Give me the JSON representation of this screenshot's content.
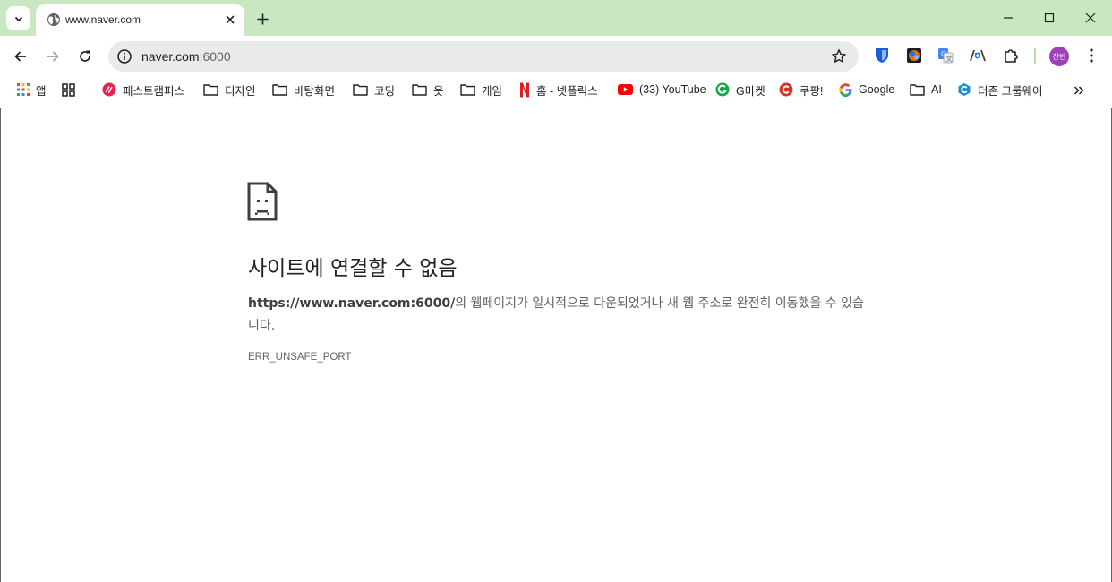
{
  "tab": {
    "title": "www.naver.com"
  },
  "omnibox": {
    "host": "naver.com",
    "port": ":6000"
  },
  "profile": {
    "initials": "찬빈",
    "color": "#9c3fb8"
  },
  "extensions": [
    "bitwarden-icon",
    "color-picker-icon",
    "google-translate-icon",
    "redux-devtools-icon",
    "puzzle-extensions-icon"
  ],
  "bookmarks": {
    "apps_label": "앱",
    "items": [
      {
        "label": "패스트캠퍼스",
        "icon": "fastcampus-icon"
      },
      {
        "label": "디자인",
        "icon": "folder-icon"
      },
      {
        "label": "바탕화면",
        "icon": "folder-icon"
      },
      {
        "label": "코딩",
        "icon": "folder-icon"
      },
      {
        "label": "옷",
        "icon": "folder-icon"
      },
      {
        "label": "게임",
        "icon": "folder-icon"
      },
      {
        "label": "홈 - 넷플릭스",
        "icon": "netflix-icon"
      },
      {
        "label": "(33) YouTube",
        "icon": "youtube-icon"
      },
      {
        "label": "G마켓",
        "icon": "gmarket-icon"
      },
      {
        "label": "쿠팡!",
        "icon": "coupang-icon"
      },
      {
        "label": "Google",
        "icon": "google-icon"
      },
      {
        "label": "AI",
        "icon": "folder-icon"
      },
      {
        "label": "더존 그룹웨어",
        "icon": "douzone-icon"
      }
    ]
  },
  "error": {
    "title": "사이트에 연결할 수 없음",
    "url": "https://www.naver.com:6000/",
    "message_rest": "의 웹페이지가 일시적으로 다운되었거나 새 웹 주소로 완전히 이동했을 수 있습니다.",
    "code": "ERR_UNSAFE_PORT"
  },
  "colors": {
    "frame": "#c9e8c1",
    "omnibox": "#e9ebe9",
    "fastcampus": "#e0264f",
    "netflix": "#d81f26",
    "youtube": "#ff0000",
    "gmarket": "#10a641",
    "coupang": "#d2342a",
    "douzone": "#1d8ad6"
  }
}
